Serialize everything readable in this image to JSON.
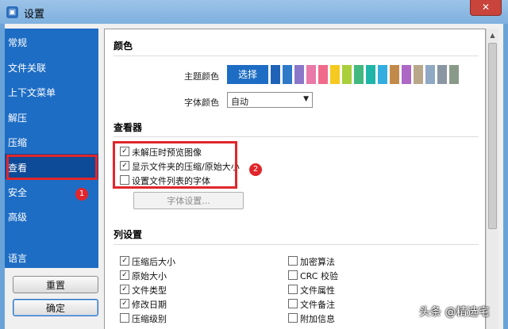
{
  "window": {
    "title": "设置",
    "close_glyph": "✕"
  },
  "sidebar": {
    "items": [
      {
        "label": "常规"
      },
      {
        "label": "文件关联"
      },
      {
        "label": "上下文菜单"
      },
      {
        "label": "解压"
      },
      {
        "label": "压缩"
      },
      {
        "label": "查看"
      },
      {
        "label": "安全"
      },
      {
        "label": "高级"
      },
      {
        "label": "语言"
      }
    ],
    "selected": "查看",
    "reset_label": "重置",
    "ok_label": "确定"
  },
  "annotations": {
    "badge1": "1",
    "badge2": "2"
  },
  "colors_section": {
    "title": "颜色",
    "theme_label": "主题颜色",
    "choose_label": "选择",
    "swatches": [
      "#1e6dc4",
      "#1e63b8",
      "#2e7ac9",
      "#8b77c9",
      "#e879a8",
      "#f06a8a",
      "#f5c91f",
      "#a9cf3a",
      "#42b87f",
      "#1fb5a8",
      "#34aee0",
      "#c28a4a",
      "#ad67c4",
      "#b9a78a",
      "#8fa9c4",
      "#8a96a2",
      "#8a9a88"
    ],
    "font_label": "字体颜色",
    "font_value": "自动"
  },
  "viewer_section": {
    "title": "查看器",
    "options": [
      {
        "label": "未解压时预览图像",
        "checked": true
      },
      {
        "label": "显示文件夹的压缩/原始大小",
        "checked": true
      },
      {
        "label": "设置文件列表的字体",
        "checked": false
      }
    ],
    "font_settings_label": "字体设置..."
  },
  "columns_section": {
    "title": "列设置",
    "left": [
      {
        "label": "压缩后大小",
        "checked": true
      },
      {
        "label": "原始大小",
        "checked": true
      },
      {
        "label": "文件类型",
        "checked": true
      },
      {
        "label": "修改日期",
        "checked": true
      },
      {
        "label": "压缩级别",
        "checked": false
      }
    ],
    "right": [
      {
        "label": "加密算法",
        "checked": false
      },
      {
        "label": "CRC 校验",
        "checked": false
      },
      {
        "label": "文件属性",
        "checked": false
      },
      {
        "label": "文件备注",
        "checked": false
      },
      {
        "label": "附加信息",
        "checked": false
      }
    ]
  },
  "watermark": "头条 @精选宅",
  "icons": {
    "scroll_up": "▲",
    "dropdown": "▼",
    "check": "✓"
  }
}
